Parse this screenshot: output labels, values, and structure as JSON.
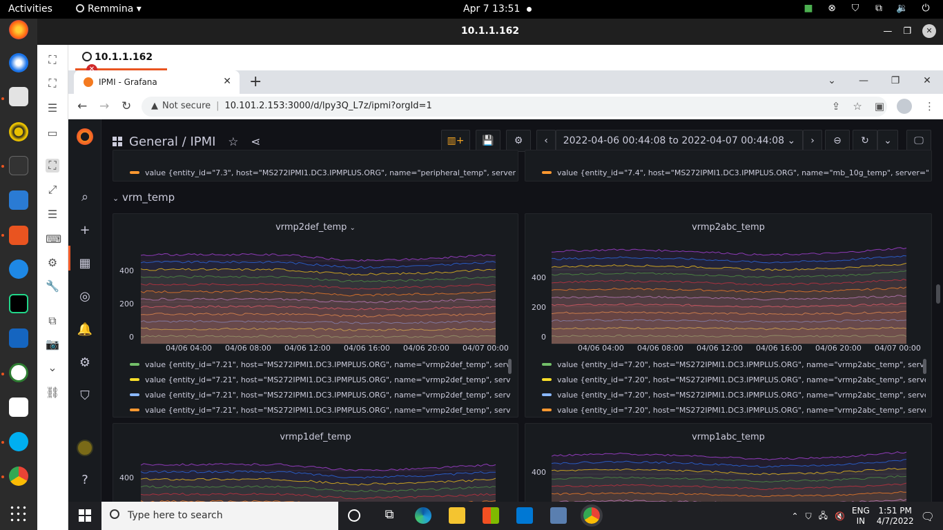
{
  "topbar": {
    "activities": "Activities",
    "app_menu": "Remmina ▾",
    "clock": "Apr 7  13:51"
  },
  "remmina": {
    "window_title": "10.1.1.162",
    "tab_label": "10.1.1.162"
  },
  "chrome": {
    "tab_title": "IPMI - Grafana",
    "security": "Not secure",
    "url": "10.101.2.153:3000/d/lpy3Q_L7z/ipmi?orgId=1"
  },
  "grafana": {
    "breadcrumb_folder": "General",
    "breadcrumb_sep": "/",
    "breadcrumb_dashboard": "IPMI",
    "time_range": "2022-04-06 00:44:08 to 2022-04-07 00:44:08",
    "top_legend_left": "value {entity_id=\"7.3\", host=\"MS272IPMI1.DC3.IPMPLUS.ORG\", name=\"peripheral_temp\", server=\"",
    "top_legend_right": "value {entity_id=\"7.4\", host=\"MS272IPMI1.DC3.IPMPLUS.ORG\", name=\"mb_10g_temp\", server=\"10",
    "row_title": "vrm_temp",
    "panels": [
      {
        "title": "vrmp2def_temp",
        "yticks": [
          "400",
          "200",
          "0"
        ],
        "xticks": [
          "04/06 04:00",
          "04/06 08:00",
          "04/06 12:00",
          "04/06 16:00",
          "04/06 20:00",
          "04/07 00:00"
        ],
        "legend": [
          "value {entity_id=\"7.21\", host=\"MS272IPMI1.DC3.IPMPLUS.ORG\", name=\"vrmp2def_temp\", server=\"",
          "value {entity_id=\"7.21\", host=\"MS272IPMI1.DC3.IPMPLUS.ORG\", name=\"vrmp2def_temp\", server=\"",
          "value {entity_id=\"7.21\", host=\"MS272IPMI1.DC3.IPMPLUS.ORG\", name=\"vrmp2def_temp\", server=\"",
          "value {entity_id=\"7.21\", host=\"MS272IPMI1.DC3.IPMPLUS.ORG\", name=\"vrmp2def_temp\", server=\""
        ]
      },
      {
        "title": "vrmp2abc_temp",
        "yticks": [
          "400",
          "200",
          "0"
        ],
        "xticks": [
          "04/06 04:00",
          "04/06 08:00",
          "04/06 12:00",
          "04/06 16:00",
          "04/06 20:00",
          "04/07 00:00"
        ],
        "legend": [
          "value {entity_id=\"7.20\", host=\"MS272IPMI1.DC3.IPMPLUS.ORG\", name=\"vrmp2abc_temp\", server=",
          "value {entity_id=\"7.20\", host=\"MS272IPMI1.DC3.IPMPLUS.ORG\", name=\"vrmp2abc_temp\", server=",
          "value {entity_id=\"7.20\", host=\"MS272IPMI1.DC3.IPMPLUS.ORG\", name=\"vrmp2abc_temp\", server=",
          "value {entity_id=\"7.20\", host=\"MS272IPMI1.DC3.IPMPLUS.ORG\", name=\"vrmp2abc_temp\", server="
        ]
      },
      {
        "title": "vrmp1def_temp",
        "yticks": [
          "400"
        ]
      },
      {
        "title": "vrmp1abc_temp",
        "yticks": [
          "400"
        ]
      }
    ],
    "legend_colors": [
      "#73bf69",
      "#fade2a",
      "#8ab8ff",
      "#ff9830"
    ],
    "series_colors": [
      "#73bf69",
      "#fade2a",
      "#5794f2",
      "#ff9830",
      "#f2495c",
      "#b877d9",
      "#ff780a",
      "#c4162a",
      "#37872d",
      "#e0b400",
      "#1f60c4",
      "#8f3bb8"
    ]
  },
  "taskbar": {
    "search_placeholder": "Type here to search",
    "lang_top": "ENG",
    "lang_bottom": "IN",
    "time": "1:51 PM",
    "date": "4/7/2022"
  },
  "chart_data": [
    {
      "type": "line",
      "title": "vrmp2def_temp",
      "ylim": [
        0,
        500
      ],
      "x": [
        "04/06 04:00",
        "04/06 08:00",
        "04/06 12:00",
        "04/06 16:00",
        "04/06 20:00",
        "04/07 00:00"
      ],
      "series_count": 12,
      "approx_stacked_top": [
        430,
        430,
        430,
        400,
        410,
        430
      ],
      "legend_placement": "bottom"
    },
    {
      "type": "line",
      "title": "vrmp2abc_temp",
      "ylim": [
        0,
        500
      ],
      "x": [
        "04/06 04:00",
        "04/06 08:00",
        "04/06 12:00",
        "04/06 16:00",
        "04/06 20:00",
        "04/07 00:00"
      ],
      "series_count": 12,
      "approx_stacked_top": [
        500,
        510,
        500,
        480,
        490,
        520
      ],
      "legend_placement": "bottom"
    }
  ]
}
